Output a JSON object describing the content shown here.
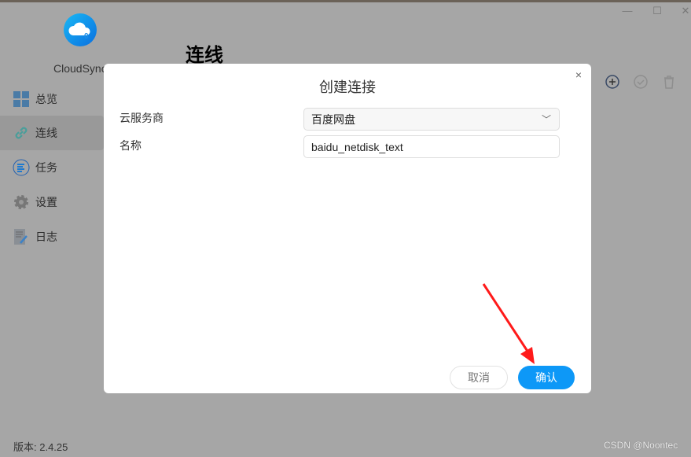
{
  "app": {
    "name": "CloudSync",
    "version": "版本: 2.4.25",
    "watermark": "CSDN @Noontec"
  },
  "window": {
    "minimize": "—",
    "maximize": "☐",
    "close": "✕"
  },
  "sidebar": {
    "items": [
      {
        "label": "总览",
        "icon": "dashboard-icon"
      },
      {
        "label": "连线",
        "icon": "link-icon",
        "active": true
      },
      {
        "label": "任务",
        "icon": "task-list-icon"
      },
      {
        "label": "设置",
        "icon": "gear-icon"
      },
      {
        "label": "日志",
        "icon": "log-icon"
      }
    ]
  },
  "page": {
    "title": "连线"
  },
  "dialog": {
    "title": "创建连接",
    "close": "×",
    "provider_label": "云服务商",
    "provider_value": "百度网盘",
    "name_label": "名称",
    "name_value": "baidu_netdisk_text",
    "cancel": "取消",
    "confirm": "确认"
  },
  "colors": {
    "accent": "#0d98f7",
    "overlay": "#a6a6a6",
    "arrow": "#ff1a1a"
  }
}
